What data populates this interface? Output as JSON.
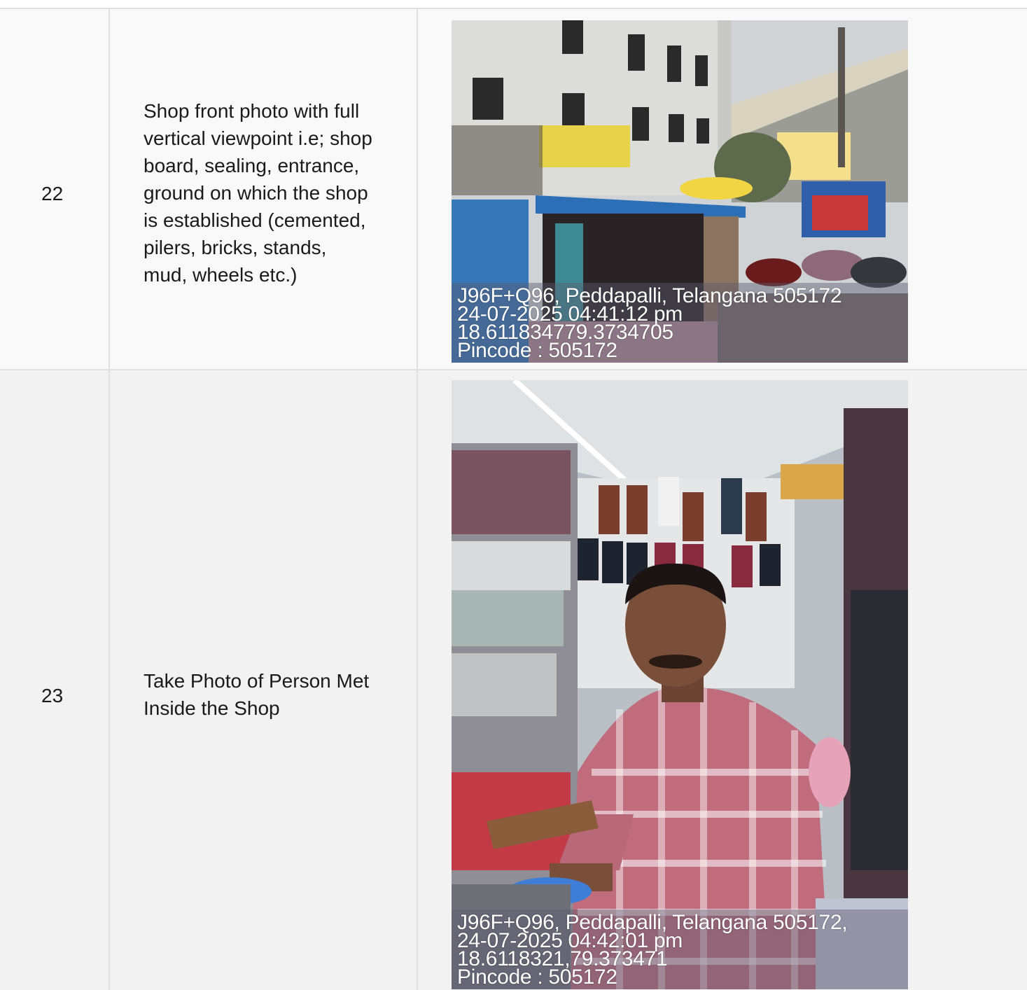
{
  "rows": [
    {
      "sno": "22",
      "description": "Shop front photo with full\nvertical viewpoint i.e; shop\nboard, sealing, entrance,\nground on which the shop\nis established (cemented,\npilers, bricks, stands,\nmud, wheels etc.)",
      "photo": {
        "subject": "shop-front",
        "stamp": {
          "address": "J96F+Q96, Peddapalli, Telangana 505172",
          "datetime": "24-07-2025 04:41:12 pm",
          "coordinates": "18.611834779.3734705",
          "pincode": "Pincode : 505172"
        }
      }
    },
    {
      "sno": "23",
      "description": "Take Photo of Person Met\nInside the Shop",
      "photo": {
        "subject": "person-inside-shop",
        "stamp": {
          "address": "J96F+Q96, Peddapalli, Telangana 505172,",
          "datetime": "24-07-2025 04:42:01 pm",
          "coordinates": "18.6118321,79.373471",
          "pincode": "Pincode : 505172"
        }
      }
    }
  ],
  "colors": {
    "grid": "#e0e0e0",
    "row_bg": "#f2f2f2",
    "text": "#1a1a1a"
  }
}
